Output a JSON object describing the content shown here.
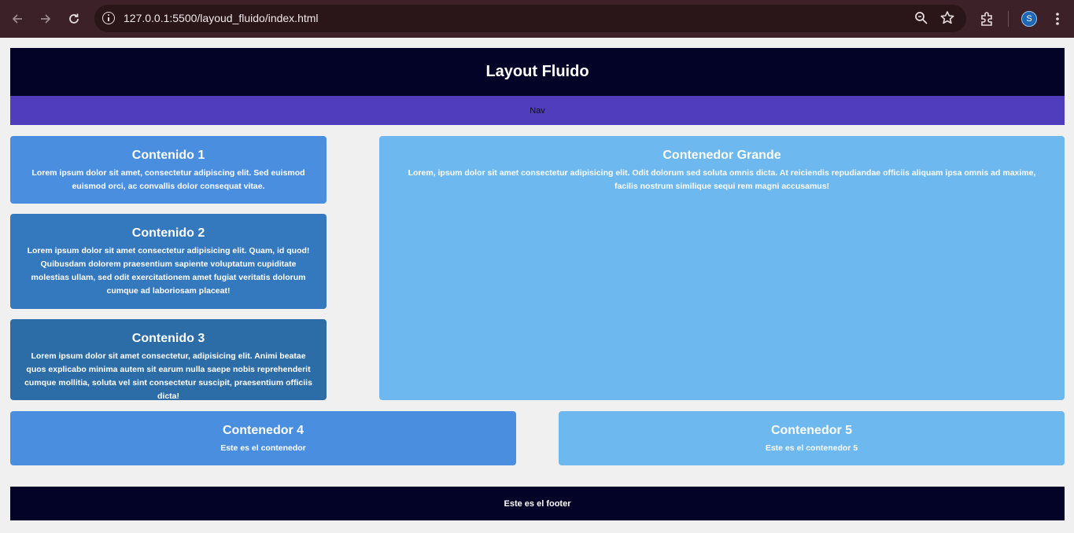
{
  "browser": {
    "url": "127.0.0.1:5500/layoud_fluido/index.html",
    "profile_initial": "S",
    "icons": [
      "back-icon",
      "forward-icon",
      "reload-icon",
      "site-info-icon",
      "zoom-icon",
      "bookmark-star-icon",
      "extensions-icon",
      "menu-icon"
    ]
  },
  "page": {
    "header": {
      "title": "Layout Fluido"
    },
    "nav": {
      "label": "Nav"
    },
    "contents": [
      {
        "title": "Contenido 1",
        "text": "Lorem ipsum dolor sit amet, consectetur adipiscing elit. Sed euismod euismod orci, ac convallis dolor consequat vitae."
      },
      {
        "title": "Contenido 2",
        "text": "Lorem ipsum dolor sit amet consectetur adipisicing elit. Quam, id quod! Quibusdam dolorem praesentium sapiente voluptatum cupiditate molestias ullam, sed odit exercitationem amet fugiat veritatis dolorum cumque ad laboriosam placeat!"
      },
      {
        "title": "Contenido 3",
        "text": "Lorem ipsum dolor sit amet consectetur, adipisicing elit. Animi beatae quos explicabo minima autem sit earum nulla saepe nobis reprehenderit cumque mollitia, soluta vel sint consectetur suscipit, praesentium officiis dicta!"
      }
    ],
    "big": {
      "title": "Contenedor Grande",
      "text": "Lorem, ipsum dolor sit amet consectetur adipisicing elit. Odit dolorum sed soluta omnis dicta. At reiciendis repudiandae officiis aliquam ipsa omnis ad maxime, facilis nostrum similique sequi rem magni accusamus!"
    },
    "container4": {
      "title": "Contenedor 4",
      "text": "Este es el contenedor"
    },
    "container5": {
      "title": "Contenedor 5",
      "text": "Este es el contenedor 5"
    },
    "footer": {
      "text": "Este es el footer"
    }
  },
  "colors": {
    "header_bg": "#020327",
    "nav_bg": "#4f3dbd",
    "content1_bg": "#4a8ee0",
    "content2_bg": "#3478be",
    "content3_bg": "#2d6da7",
    "big_bg": "#6db8ee",
    "page_bg": "#f0f0f0"
  }
}
